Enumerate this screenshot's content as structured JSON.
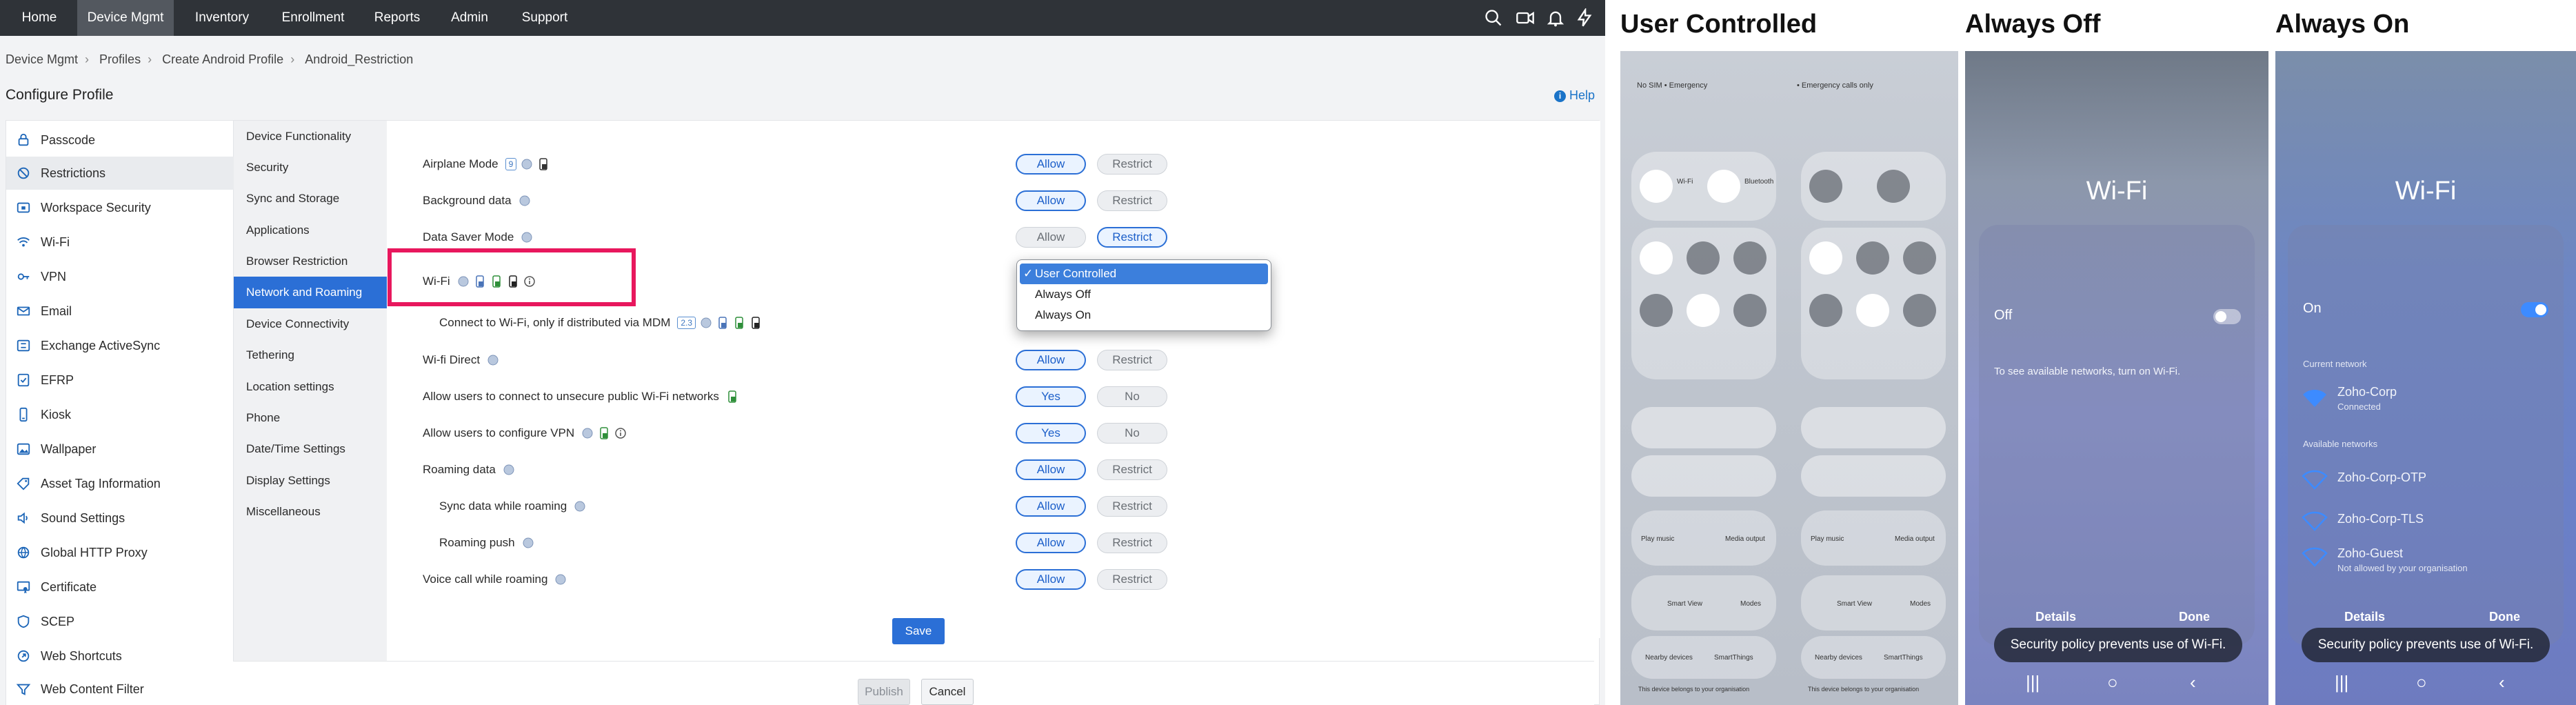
{
  "topnav": {
    "items": [
      "Home",
      "Device Mgmt",
      "Inventory",
      "Enrollment",
      "Reports",
      "Admin",
      "Support"
    ],
    "active": "Device Mgmt"
  },
  "breadcrumb": [
    "Device Mgmt",
    "Profiles",
    "Create Android Profile",
    "Android_Restriction"
  ],
  "page_title": "Configure Profile",
  "help_label": "Help",
  "categories": [
    {
      "label": "Passcode",
      "icon": "lock-icon"
    },
    {
      "label": "Restrictions",
      "icon": "restriction-icon",
      "active": true
    },
    {
      "label": "Workspace Security",
      "icon": "workspace-security-icon"
    },
    {
      "label": "Wi-Fi",
      "icon": "wifi-icon"
    },
    {
      "label": "VPN",
      "icon": "vpn-icon"
    },
    {
      "label": "Email",
      "icon": "email-icon"
    },
    {
      "label": "Exchange ActiveSync",
      "icon": "exchange-icon"
    },
    {
      "label": "EFRP",
      "icon": "efrp-icon"
    },
    {
      "label": "Kiosk",
      "icon": "kiosk-icon"
    },
    {
      "label": "Wallpaper",
      "icon": "wallpaper-icon"
    },
    {
      "label": "Asset Tag Information",
      "icon": "asset-tag-icon"
    },
    {
      "label": "Sound Settings",
      "icon": "sound-icon"
    },
    {
      "label": "Global HTTP Proxy",
      "icon": "proxy-icon"
    },
    {
      "label": "Certificate",
      "icon": "certificate-icon"
    },
    {
      "label": "SCEP",
      "icon": "scep-icon"
    },
    {
      "label": "Web Shortcuts",
      "icon": "web-shortcut-icon"
    },
    {
      "label": "Web Content Filter",
      "icon": "web-filter-icon"
    }
  ],
  "subcategories": [
    {
      "label": "Device Functionality"
    },
    {
      "label": "Security"
    },
    {
      "label": "Sync and Storage"
    },
    {
      "label": "Applications"
    },
    {
      "label": "Browser Restriction"
    },
    {
      "label": "Network and Roaming",
      "active": true
    },
    {
      "label": "Device Connectivity"
    },
    {
      "label": "Tethering"
    },
    {
      "label": "Location settings"
    },
    {
      "label": "Phone"
    },
    {
      "label": "Date/Time Settings"
    },
    {
      "label": "Display Settings"
    },
    {
      "label": "Miscellaneous"
    }
  ],
  "settings": [
    {
      "label": "Airplane Mode",
      "badge": "9",
      "left": "Allow",
      "right": "Restrict",
      "selected": "left"
    },
    {
      "label": "Background data",
      "left": "Allow",
      "right": "Restrict",
      "selected": "left"
    },
    {
      "label": "Data Saver Mode",
      "left": "Allow",
      "right": "Restrict",
      "selected": "right"
    },
    {
      "label": "Wi-Fi"
    },
    {
      "label": "Connect to Wi-Fi, only if distributed via MDM",
      "badge": "2.3"
    },
    {
      "label": "Wi-fi Direct",
      "left": "Allow",
      "right": "Restrict",
      "selected": "left"
    },
    {
      "label": "Allow users to connect to unsecure public Wi-Fi networks",
      "left": "Yes",
      "right": "No",
      "selected": "left"
    },
    {
      "label": "Allow users to configure VPN",
      "left": "Yes",
      "right": "No",
      "selected": "left"
    },
    {
      "label": "Roaming data",
      "left": "Allow",
      "right": "Restrict",
      "selected": "left"
    },
    {
      "label": "Sync data while roaming",
      "left": "Allow",
      "right": "Restrict",
      "selected": "left"
    },
    {
      "label": "Roaming push",
      "left": "Allow",
      "right": "Restrict",
      "selected": "left"
    },
    {
      "label": "Voice call while roaming",
      "left": "Allow",
      "right": "Restrict",
      "selected": "left"
    }
  ],
  "wifi_dropdown": {
    "options": [
      "User Controlled",
      "Always Off",
      "Always On"
    ],
    "selected": "User Controlled",
    "check": "✓"
  },
  "buttons": {
    "save": "Save",
    "publish": "Publish",
    "cancel": "Cancel"
  },
  "phones": {
    "titles": [
      "User Controlled",
      "Always Off",
      "Always On"
    ],
    "user_controlled": {
      "status_left": "No SIM • Emergency",
      "status_right": "• Emergency calls only",
      "wifi_label": "Wi-Fi",
      "bluetooth_label": "Bluetooth",
      "play_music": "Play music",
      "media_output": "Media output",
      "smart_view": "Smart View",
      "modes": "Modes",
      "nearby_devices": "Nearby devices",
      "smartthings": "SmartThings",
      "org_note": "This device belongs to your organisation"
    },
    "always_off": {
      "heading": "Wi-Fi",
      "state": "Off",
      "message": "To see available networks, turn on Wi-Fi.",
      "details": "Details",
      "done": "Done",
      "toast": "Security policy prevents use of Wi-Fi."
    },
    "always_on": {
      "heading": "Wi-Fi",
      "state": "On",
      "current_network_label": "Current network",
      "current_network": {
        "name": "Zoho-Corp",
        "status": "Connected"
      },
      "available_label": "Available networks",
      "available": [
        {
          "name": "Zoho-Corp-OTP",
          "note": ""
        },
        {
          "name": "Zoho-Corp-TLS",
          "note": ""
        },
        {
          "name": "Zoho-Guest",
          "note": "Not allowed by your organisation"
        }
      ],
      "details": "Details",
      "done": "Done",
      "toast": "Security policy prevents use of Wi-Fi."
    }
  },
  "colors": {
    "accent": "#2b6fd6",
    "highlight": "#e8175d",
    "nav_bg": "#2f3338"
  }
}
